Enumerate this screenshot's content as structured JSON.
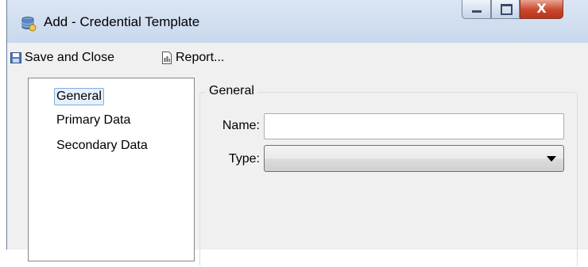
{
  "window": {
    "title": "Add - Credential Template",
    "close_glyph": "X",
    "icons": {
      "app": "database-icon",
      "minimize": "minimize-icon",
      "maximize": "maximize-icon",
      "close": "close-icon"
    }
  },
  "toolbar": {
    "save_close_label": "Save and Close",
    "save_icon": "save-icon",
    "report_label": "Report...",
    "report_icon": "report-icon"
  },
  "tree": {
    "items": [
      {
        "label": "General",
        "selected": true
      },
      {
        "label": "Primary Data",
        "selected": false
      },
      {
        "label": "Secondary Data",
        "selected": false
      }
    ]
  },
  "form": {
    "group_title": "General",
    "name_label": "Name:",
    "name_value": "",
    "type_label": "Type:",
    "type_value": ""
  },
  "colors": {
    "title_bar": "#c8d8ec",
    "close_button": "#c9472b",
    "selection_bg": "#e5f0fb",
    "selection_border": "#84acdd"
  }
}
